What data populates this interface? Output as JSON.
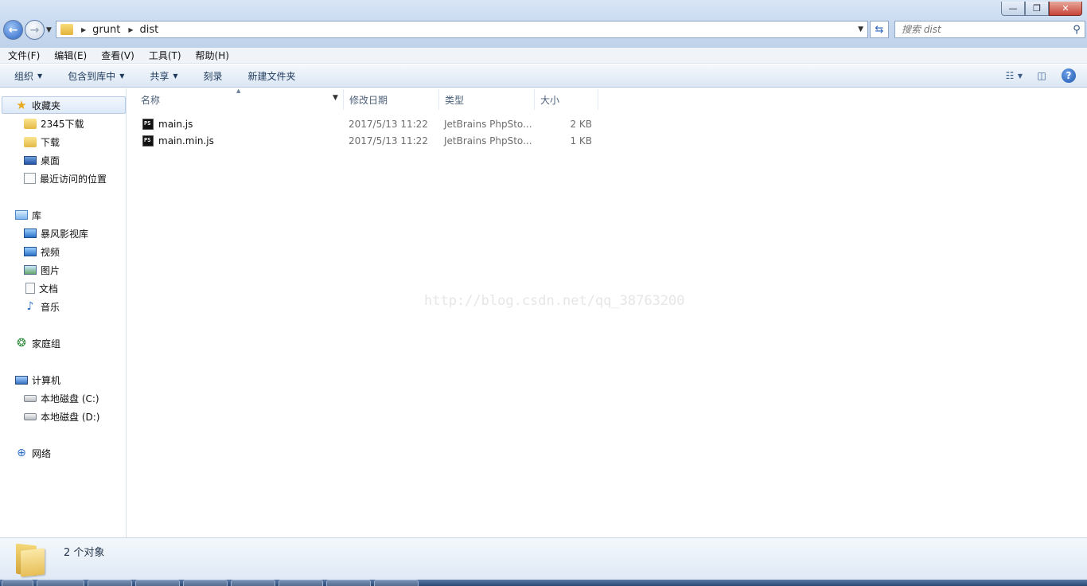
{
  "window": {
    "minimize_label": "—",
    "maximize_label": "❐",
    "close_label": "✕"
  },
  "address": {
    "crumbs": [
      "grunt",
      "dist"
    ],
    "search_placeholder": "搜索 dist"
  },
  "menu": [
    "文件(F)",
    "编辑(E)",
    "查看(V)",
    "工具(T)",
    "帮助(H)"
  ],
  "commands": {
    "organize": "组织",
    "include": "包含到库中",
    "share": "共享",
    "burn": "刻录",
    "new_folder": "新建文件夹"
  },
  "nav": {
    "favorites": "收藏夹",
    "fav_items": [
      "2345下载",
      "下载",
      "桌面",
      "最近访问的位置"
    ],
    "libraries": "库",
    "lib_items": [
      "暴风影视库",
      "视频",
      "图片",
      "文档",
      "音乐"
    ],
    "homegroup": "家庭组",
    "computer": "计算机",
    "drives": [
      "本地磁盘 (C:)",
      "本地磁盘 (D:)"
    ],
    "network": "网络"
  },
  "columns": {
    "name": "名称",
    "date": "修改日期",
    "type": "类型",
    "size": "大小"
  },
  "files": [
    {
      "name": "main.js",
      "date": "2017/5/13 11:22",
      "type": "JetBrains PhpSto...",
      "size": "2 KB",
      "icon_label": "PS"
    },
    {
      "name": "main.min.js",
      "date": "2017/5/13 11:22",
      "type": "JetBrains PhpSto...",
      "size": "1 KB",
      "icon_label": "PS"
    }
  ],
  "watermark": "http://blog.csdn.net/qq_38763200",
  "details": {
    "count": "2 个对象"
  }
}
